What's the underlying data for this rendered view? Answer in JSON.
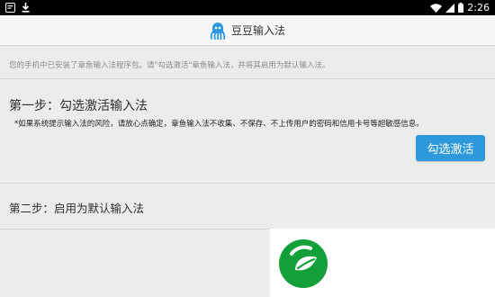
{
  "status_bar": {
    "time": "2:26",
    "left_icons": [
      "notification-icon",
      "download-icon"
    ],
    "right_icons": [
      "wifi-icon",
      "signal-icon",
      "battery-icon"
    ]
  },
  "app_bar": {
    "title": "豆豆输入法",
    "logo_icon": "octopus-logo-icon",
    "logo_color": "#2e98dd"
  },
  "content": {
    "notice": "您的手机中已安装了章鱼输入法程序包。请\"勾选激活\"章鱼输入法，并将其启用为默认输入法。",
    "step1": {
      "title": "第一步：勾选激活输入法",
      "note": "*如果系统提示输入法的风险，请放心点确定，章鱼输入法不收集、不保存、不上传用户的密码和信用卡号等超敏感信息。",
      "button_label": "勾选激活"
    },
    "step2": {
      "title": "第二步：启用为默认输入法"
    }
  },
  "watermark": {
    "icon": "green-leaf-logo-icon",
    "color": "#13a03a"
  },
  "colors": {
    "accent": "#2e98dd",
    "background": "#ececec",
    "status_bar": "#000000"
  }
}
